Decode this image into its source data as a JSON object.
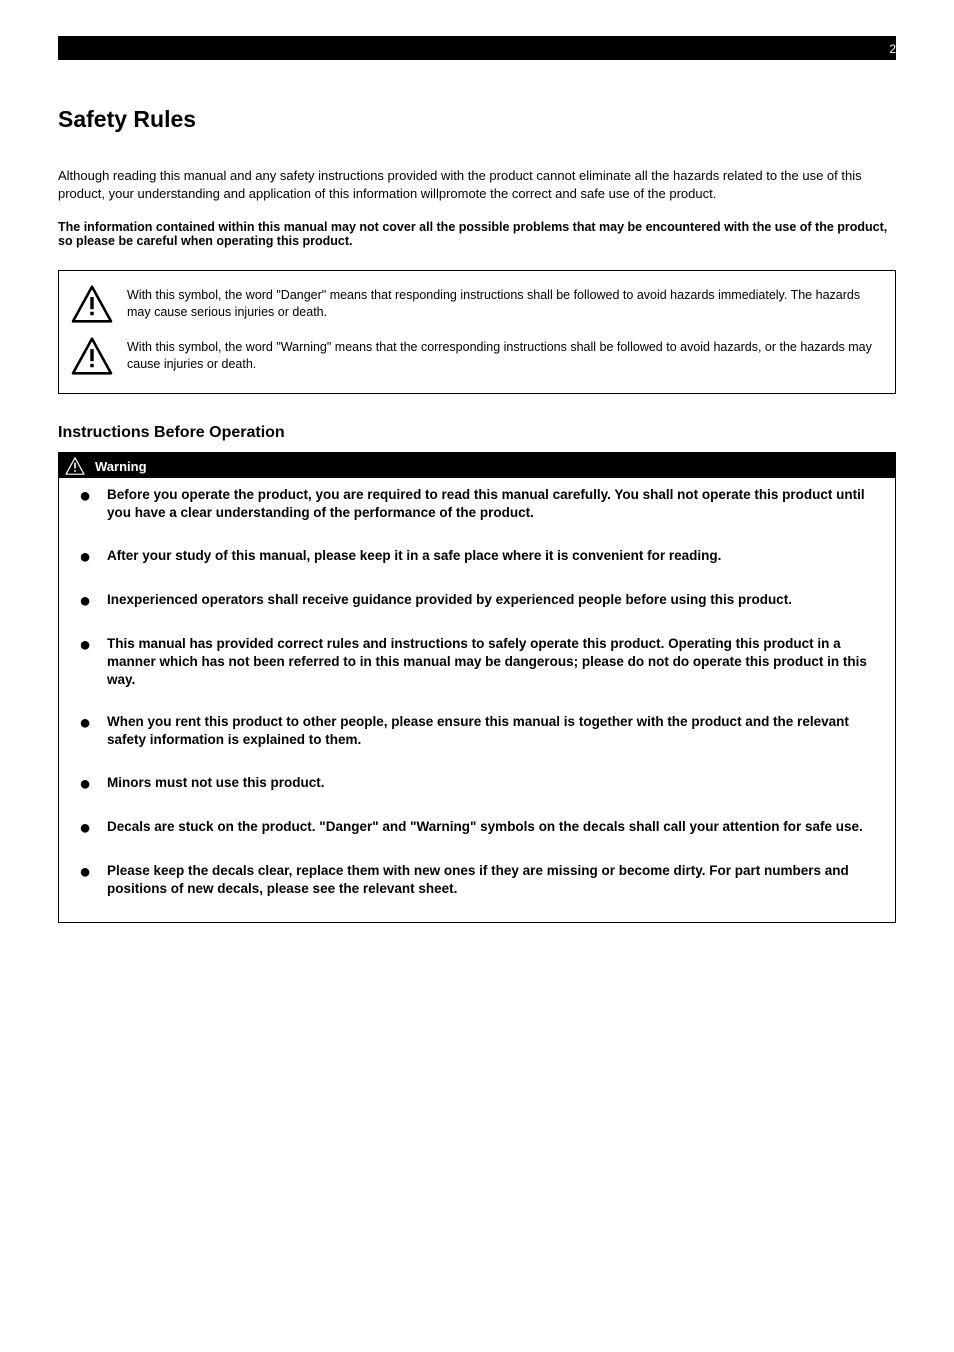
{
  "page_number": "2",
  "section_title": "Safety Rules",
  "intro_paragraph": "Although reading this manual and any safety instructions provided with the product cannot eliminate all the hazards related to the use of this product, your understanding and application of this information willpromote the correct and safe use of the product.",
  "intro_bold": "The information contained within this manual may not cover all the possible problems that may be encountered with the use of the product, so please be careful when operating this product.",
  "note_box": {
    "danger_text": "With this symbol, the word \"Danger\" means that responding instructions shall be followed to avoid hazards immediately. The hazards may cause serious injuries or death.",
    "warning_text": "With this symbol, the word \"Warning\" means that the corresponding instructions shall be followed to avoid hazards, or the hazards may cause injuries or death."
  },
  "instructions": {
    "title": "Instructions Before Operation",
    "header_label": "Warning",
    "items": [
      "Before you operate the product, you are required to read this manual carefully. You shall not operate this product until you have a clear understanding of the performance of the product.",
      "After your study of this manual, please keep it in a safe place where it is convenient for reading.",
      "Inexperienced operators shall receive guidance provided by experienced people before using this product.",
      "This manual has provided correct rules and instructions to safely operate this product. Operating this product in a manner which has not been referred to in this manual may be dangerous; please do not do operate this product in this way.",
      "When you rent this product to other people, please ensure this manual is together with the product and the relevant safety information is explained to them.",
      "Minors must not use this product.",
      "Decals are stuck on the product. \"Danger\" and \"Warning\" symbols on the decals shall call your attention for safe use.",
      "Please keep the decals clear, replace them with new ones if they are missing or become dirty. For part numbers and positions of new decals, please see the relevant sheet."
    ]
  }
}
